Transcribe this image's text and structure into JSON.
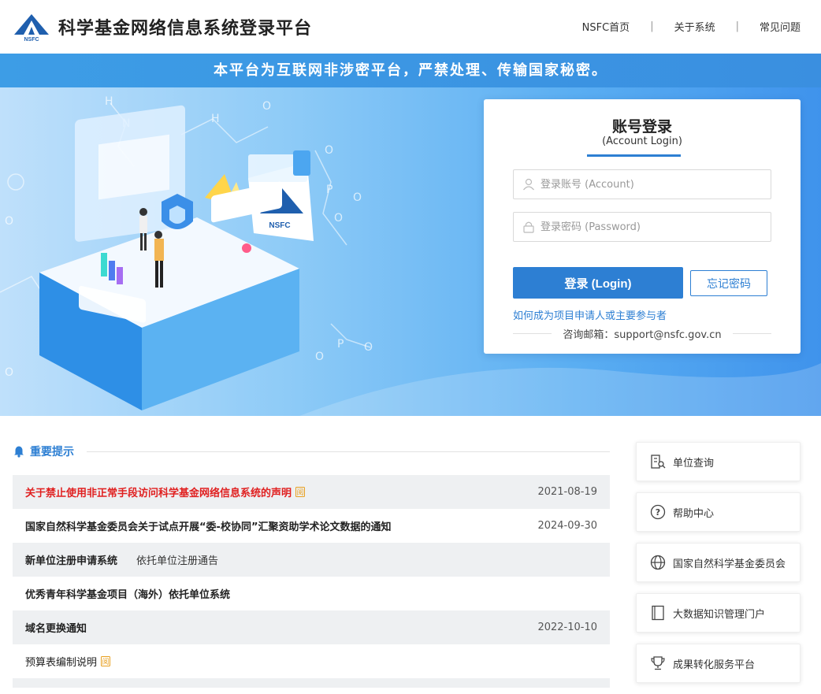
{
  "header": {
    "logo_text": "NSFC",
    "title": "科学基金网络信息系统登录平台",
    "nav": [
      {
        "label": "NSFC首页"
      },
      {
        "label": "关于系统"
      },
      {
        "label": "常见问题"
      }
    ],
    "nav_separator": "|"
  },
  "notice_banner": "本平台为互联网非涉密平台，严禁处理、传输国家秘密。",
  "hero": {
    "logo_text": "NSFC"
  },
  "login": {
    "title": "账号登录",
    "subtitle": "(Account Login)",
    "account_placeholder": "登录账号 (Account)",
    "password_placeholder": "登录密码 (Password)",
    "login_button": "登录 (Login)",
    "forgot_button": "忘记密码",
    "how_to_link": "如何成为项目申请人或主要参与者",
    "contact": "咨询邮箱：support@nsfc.gov.cn"
  },
  "notices": {
    "section_title": "重要提示",
    "items": [
      {
        "title": "关于禁止使用非正常手段访问科学基金网络信息系统的声明",
        "date": "2021-08-19",
        "badge": "阅",
        "style": "red"
      },
      {
        "title": "国家自然科学基金委员会关于试点开展“委-校协同”汇聚资助学术论文数据的通知",
        "date": "2024-09-30",
        "style": "bold"
      },
      {
        "title": "新单位注册申请系统",
        "secondary_link": "依托单位注册通告",
        "date": "",
        "style": "bold"
      },
      {
        "title": "优秀青年科学基金项目（海外）依托单位系统",
        "date": "",
        "style": "bold"
      },
      {
        "title": "域名更换通知",
        "date": "2022-10-10",
        "style": "bold"
      },
      {
        "title": "预算表编制说明",
        "date": "",
        "badge": "阅",
        "style": "normal"
      }
    ]
  },
  "side_links": [
    {
      "label": "单位查询",
      "icon": "building-search-icon"
    },
    {
      "label": "帮助中心",
      "icon": "question-circle-icon"
    },
    {
      "label": "国家自然科学基金委员会",
      "icon": "globe-icon"
    },
    {
      "label": "大数据知识管理门户",
      "icon": "book-icon"
    },
    {
      "label": "成果转化服务平台",
      "icon": "trophy-icon"
    }
  ],
  "colors": {
    "brand_blue": "#2d7fd3",
    "banner_blue": "#3d9de6",
    "alert_red": "#e02020"
  }
}
